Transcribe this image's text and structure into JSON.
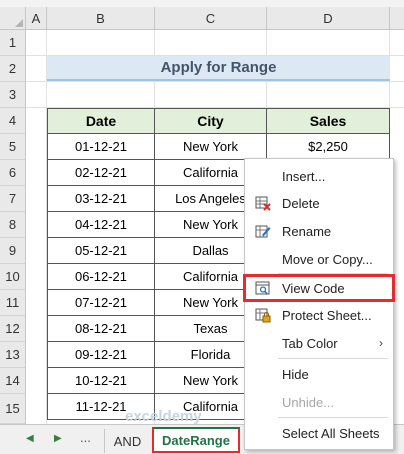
{
  "columns": [
    "A",
    "B",
    "C",
    "D"
  ],
  "rows": [
    "1",
    "2",
    "3",
    "4",
    "5",
    "6",
    "7",
    "8",
    "9",
    "10",
    "11",
    "12",
    "13",
    "14",
    "15"
  ],
  "title": "Apply for Range",
  "table": {
    "headers": [
      "Date",
      "City",
      "Sales"
    ],
    "rows": [
      [
        "01-12-21",
        "New York",
        "$2,250"
      ],
      [
        "02-12-21",
        "California",
        ""
      ],
      [
        "03-12-21",
        "Los Angeles",
        ""
      ],
      [
        "04-12-21",
        "New York",
        ""
      ],
      [
        "05-12-21",
        "Dallas",
        ""
      ],
      [
        "06-12-21",
        "California",
        ""
      ],
      [
        "07-12-21",
        "New York",
        ""
      ],
      [
        "08-12-21",
        "Texas",
        ""
      ],
      [
        "09-12-21",
        "Florida",
        ""
      ],
      [
        "10-12-21",
        "New York",
        ""
      ],
      [
        "11-12-21",
        "California",
        ""
      ]
    ]
  },
  "context_menu": {
    "items": [
      {
        "label": "Insert...",
        "icon": "none"
      },
      {
        "label": "Delete",
        "icon": "delete-sheet-icon"
      },
      {
        "label": "Rename",
        "icon": "rename-icon"
      },
      {
        "label": "Move or Copy...",
        "icon": "none"
      },
      {
        "label": "View Code",
        "icon": "view-code-icon",
        "highlighted": true
      },
      {
        "label": "Protect Sheet...",
        "icon": "protect-sheet-icon"
      },
      {
        "label": "Tab Color",
        "icon": "none",
        "submenu": true
      },
      {
        "label": "Hide",
        "icon": "none"
      },
      {
        "label": "Unhide...",
        "icon": "none",
        "disabled": true
      },
      {
        "label": "Select All Sheets",
        "icon": "none"
      }
    ],
    "submenu_arrow": "›"
  },
  "sheet_tabs": {
    "nav_prev": "◀",
    "nav_next": "▶",
    "ellipsis": "...",
    "tabs": [
      "AND",
      "DateRange"
    ],
    "active": "DateRange"
  },
  "colors": {
    "highlight_border": "#e52b2b",
    "excel_green": "#217346",
    "title_fill": "#dce9f5",
    "header_fill": "#e2efda"
  }
}
